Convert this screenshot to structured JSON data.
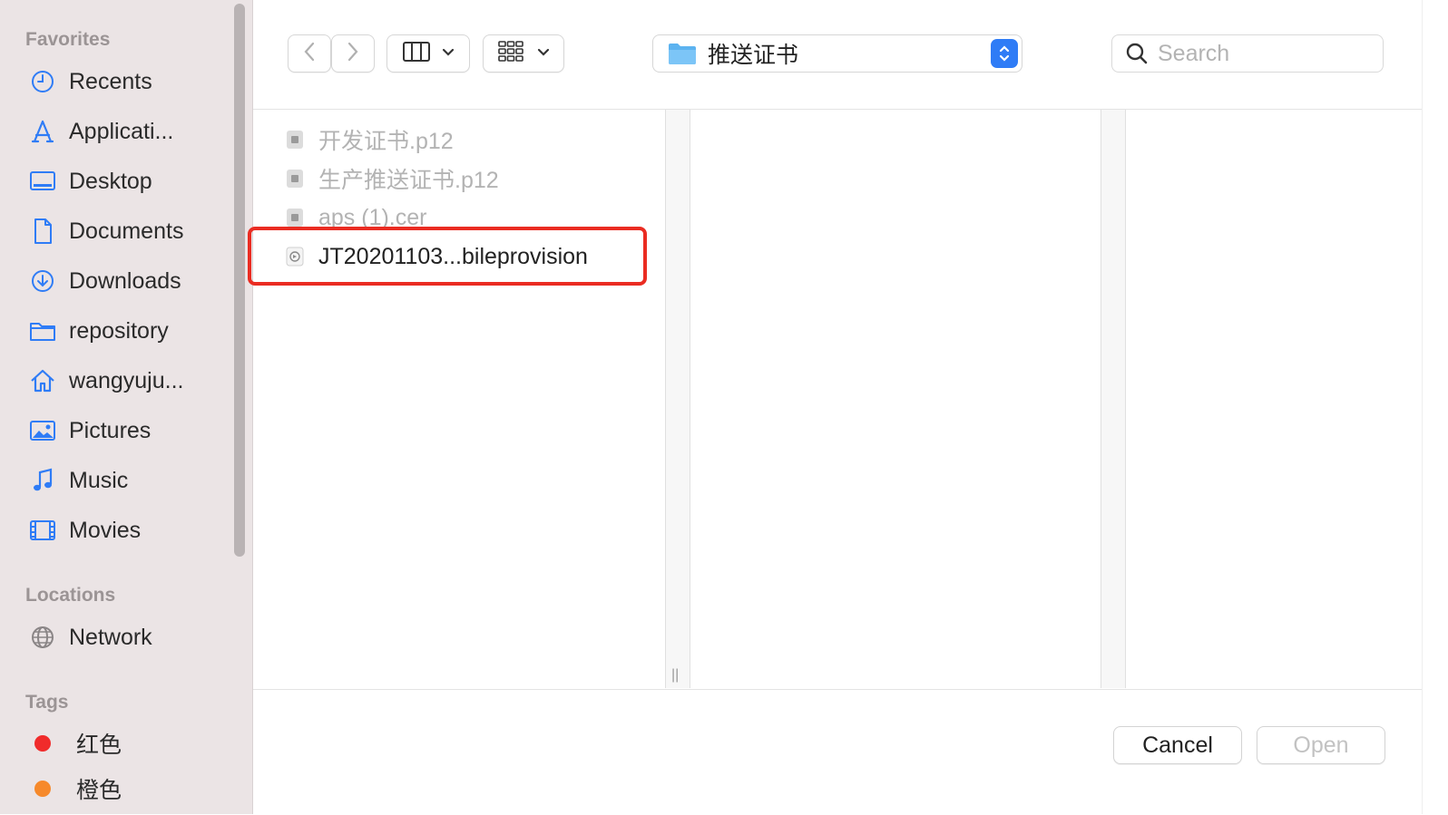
{
  "sidebar": {
    "favorites_title": "Favorites",
    "favorites": [
      {
        "label": "Recents",
        "icon": "clock-icon"
      },
      {
        "label": "Applicati...",
        "icon": "applications-icon"
      },
      {
        "label": "Desktop",
        "icon": "desktop-icon"
      },
      {
        "label": "Documents",
        "icon": "document-icon"
      },
      {
        "label": "Downloads",
        "icon": "download-icon"
      },
      {
        "label": "repository",
        "icon": "folder-icon"
      },
      {
        "label": "wangyuju...",
        "icon": "home-icon"
      },
      {
        "label": "Pictures",
        "icon": "pictures-icon"
      },
      {
        "label": "Music",
        "icon": "music-icon"
      },
      {
        "label": "Movies",
        "icon": "movies-icon"
      }
    ],
    "locations_title": "Locations",
    "locations": [
      {
        "label": "Network",
        "icon": "globe-icon"
      }
    ],
    "tags_title": "Tags",
    "tags": [
      {
        "label": "红色",
        "color": "#f02b2b"
      },
      {
        "label": "橙色",
        "color": "#f6892b"
      }
    ]
  },
  "toolbar": {
    "path_folder": "推送证书",
    "search_placeholder": "Search"
  },
  "files": [
    {
      "name": "开发证书.p12",
      "enabled": false
    },
    {
      "name": "生产推送证书.p12",
      "enabled": false
    },
    {
      "name": "aps (1).cer",
      "enabled": false
    },
    {
      "name": "JT20201103...bileprovision",
      "enabled": true
    }
  ],
  "buttons": {
    "cancel": "Cancel",
    "open": "Open"
  },
  "colors": {
    "accent": "#2f7cf6",
    "highlight": "#ea2c22",
    "sidebar_bg": "#ebe4e5"
  }
}
